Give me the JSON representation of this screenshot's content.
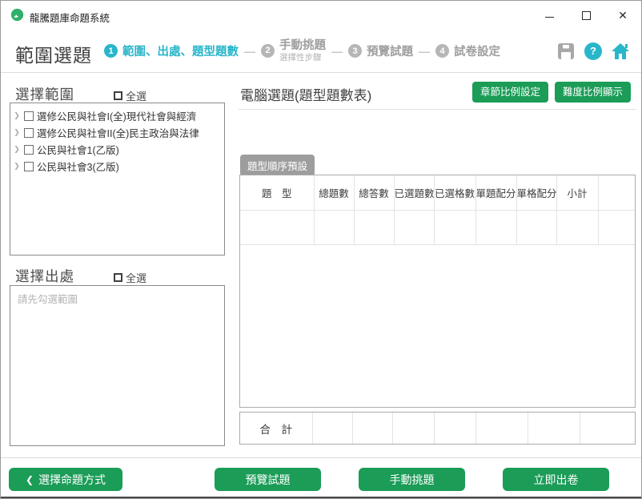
{
  "titlebar": {
    "app_title": "龍騰題庫命題系統"
  },
  "icons": {
    "minimize": "",
    "maximize": "",
    "close": "✕",
    "help": "?",
    "back_arrow": "❮",
    "tree_chevron": "❯",
    "step_dash": "—"
  },
  "header": {
    "page_title": "範圍選題",
    "steps": [
      {
        "num": "1",
        "label": "範圍、出處、題型題數",
        "sub": ""
      },
      {
        "num": "2",
        "label": "手動挑題",
        "sub": "選擇性步驟"
      },
      {
        "num": "3",
        "label": "預覽試題",
        "sub": ""
      },
      {
        "num": "4",
        "label": "試卷設定",
        "sub": ""
      }
    ]
  },
  "range_panel": {
    "title": "選擇範圍",
    "select_all_label": "全選",
    "items": [
      {
        "label": "選修公民與社會I(全)現代社會與經濟"
      },
      {
        "label": "選修公民與社會II(全)民主政治與法律"
      },
      {
        "label": "公民與社會1(乙版)"
      },
      {
        "label": "公民與社會3(乙版)"
      }
    ]
  },
  "source_panel": {
    "title": "選擇出處",
    "select_all_label": "全選",
    "placeholder": "請先勾選範圍"
  },
  "main": {
    "title": "電腦選題(題型題數表)",
    "chapter_ratio_button": "章節比例設定",
    "difficulty_ratio_button": "難度比例顯示",
    "order_tag": "題型順序預設",
    "table": {
      "headers": [
        "題　型",
        "總題數",
        "總答數",
        "已選題數",
        "已選格數",
        "單題配分",
        "單格配分",
        "小計",
        ""
      ]
    },
    "footer_row": {
      "label": "合　計"
    }
  },
  "bottom": {
    "back_button": "選擇命題方式",
    "preview_button": "預覽試題",
    "manual_button": "手動挑題",
    "generate_button": "立即出卷"
  },
  "colors": {
    "accent_cyan": "#29b6ca",
    "brand_green": "#1b9c57",
    "step_inactive_gray": "#b6b6b6",
    "tag_gray": "#9d9d9d"
  }
}
